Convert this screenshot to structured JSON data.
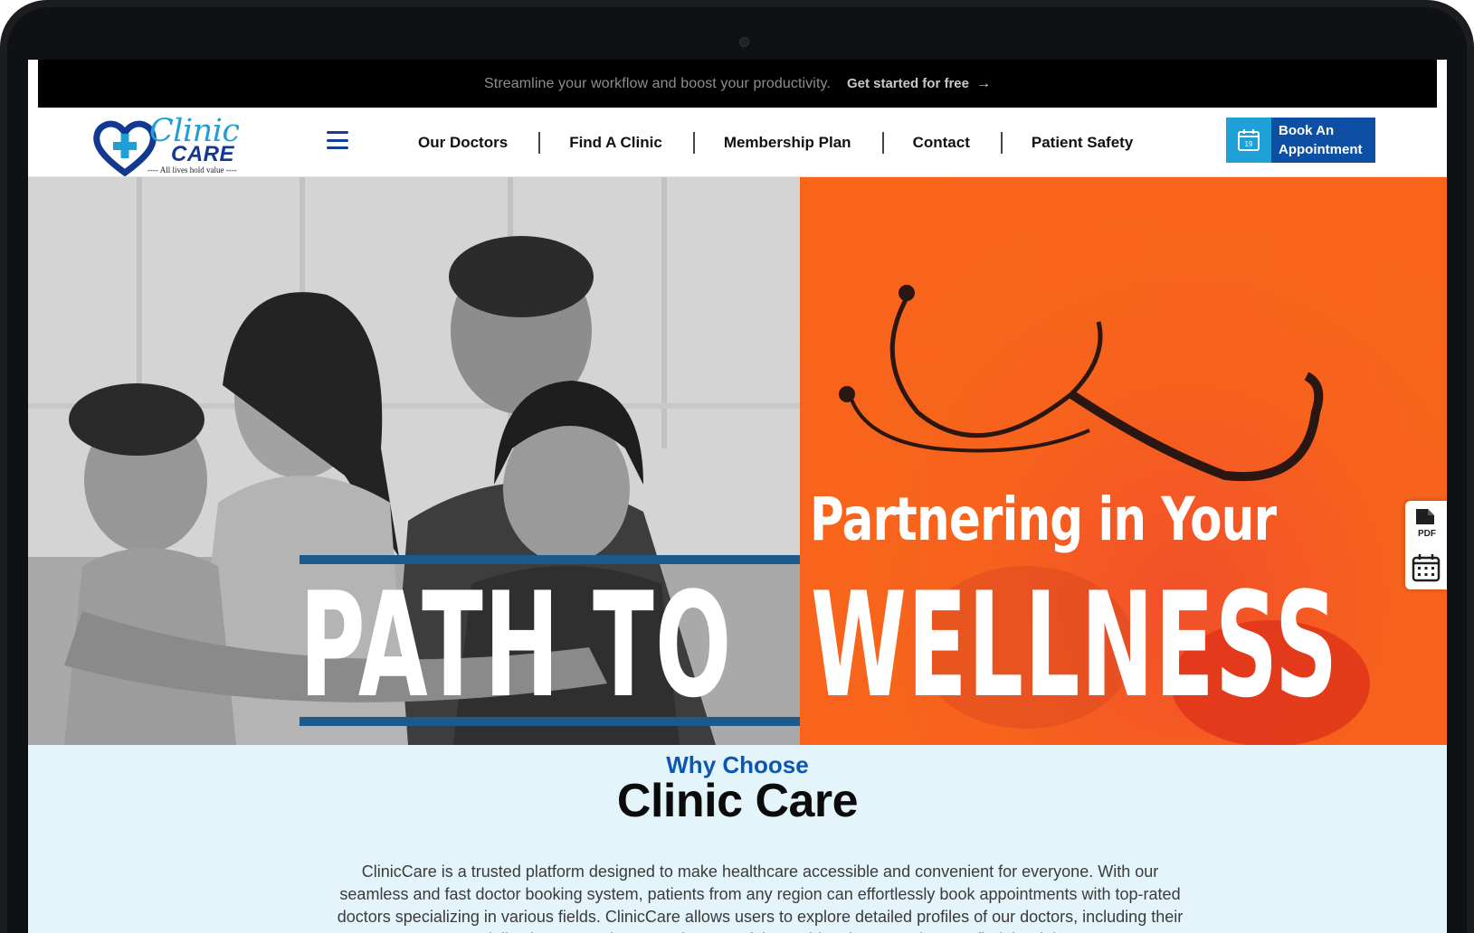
{
  "announcement": {
    "text": "Streamline your workflow and boost your productivity.",
    "cta": "Get started for free",
    "cta_icon": "arrow-right-icon"
  },
  "header": {
    "logo": {
      "script": "Clinic",
      "word": "CARE",
      "tagline": "---- All lives hold value ----"
    },
    "menu_icon": "hamburger-icon",
    "nav": [
      {
        "label": "Our Doctors"
      },
      {
        "label": "Find A Clinic"
      },
      {
        "label": "Membership Plan"
      },
      {
        "label": "Contact"
      },
      {
        "label": "Patient Safety"
      }
    ],
    "book_button": {
      "line1": "Book An",
      "line2": "Appointment",
      "icon": "calendar-icon",
      "icon_day": "19"
    }
  },
  "hero": {
    "subheading": "Partnering in Your",
    "heading_left": "PATH TO",
    "heading_right": "WELLNESS",
    "accent_color": "#1a5b8f",
    "right_bg_color": "#f8651a",
    "side_tools": [
      {
        "icon": "pdf-icon",
        "label": "PDF"
      },
      {
        "icon": "calendar-grid-icon"
      }
    ],
    "floating_tools": [
      {
        "icon": "chat-icon"
      },
      {
        "icon": "eye-icon"
      },
      {
        "icon": "list-icon"
      }
    ]
  },
  "why": {
    "eyebrow": "Why Choose",
    "title": "Clinic Care",
    "body": "ClinicCare is a trusted platform designed to make healthcare accessible and convenient for everyone. With our seamless and fast doctor booking system, patients from any region can effortlessly book appointments with top-rated doctors specializing in various fields. ClinicCare allows users to explore detailed profiles of our doctors, including their specializations, experience, and successful case histories, ensuring you find the right"
  }
}
